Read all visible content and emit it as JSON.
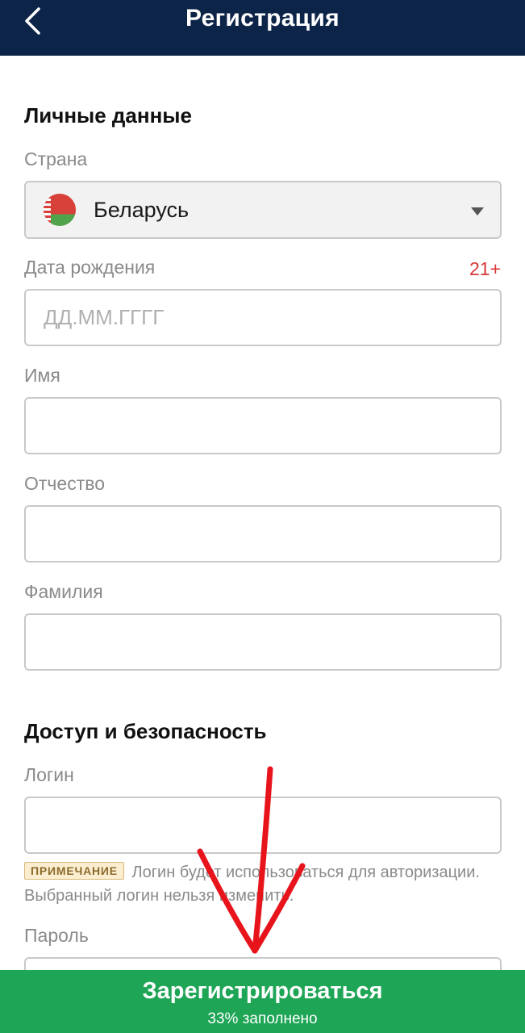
{
  "header": {
    "title": "Регистрация",
    "back_icon": "chevron-left-icon"
  },
  "personal": {
    "section_title": "Личные данные",
    "country": {
      "label": "Страна",
      "value": "Беларусь",
      "flag_icon": "belarus-flag-icon"
    },
    "birth_date": {
      "label": "Дата рождения",
      "age_limit": "21+",
      "placeholder": "ДД.ММ.ГГГГ",
      "value": ""
    },
    "first_name": {
      "label": "Имя",
      "value": ""
    },
    "patronymic": {
      "label": "Отчество",
      "value": ""
    },
    "last_name": {
      "label": "Фамилия",
      "value": ""
    }
  },
  "security": {
    "section_title": "Доступ и безопасность",
    "login": {
      "label": "Логин",
      "value": "",
      "note_badge": "ПРИМЕЧАНИЕ",
      "note_text": "Логин будет использоваться для авторизации. Выбранный логин нельзя изменить."
    },
    "password": {
      "label": "Пароль",
      "value": ""
    }
  },
  "submit": {
    "label": "Зарегистрироваться",
    "progress_text": "33% заполнено",
    "progress_percent": 33
  },
  "colors": {
    "header_bg": "#0d2449",
    "submit_bg": "#1ea556",
    "age_badge": "#d93636",
    "annotation_arrow": "#e8141c"
  }
}
